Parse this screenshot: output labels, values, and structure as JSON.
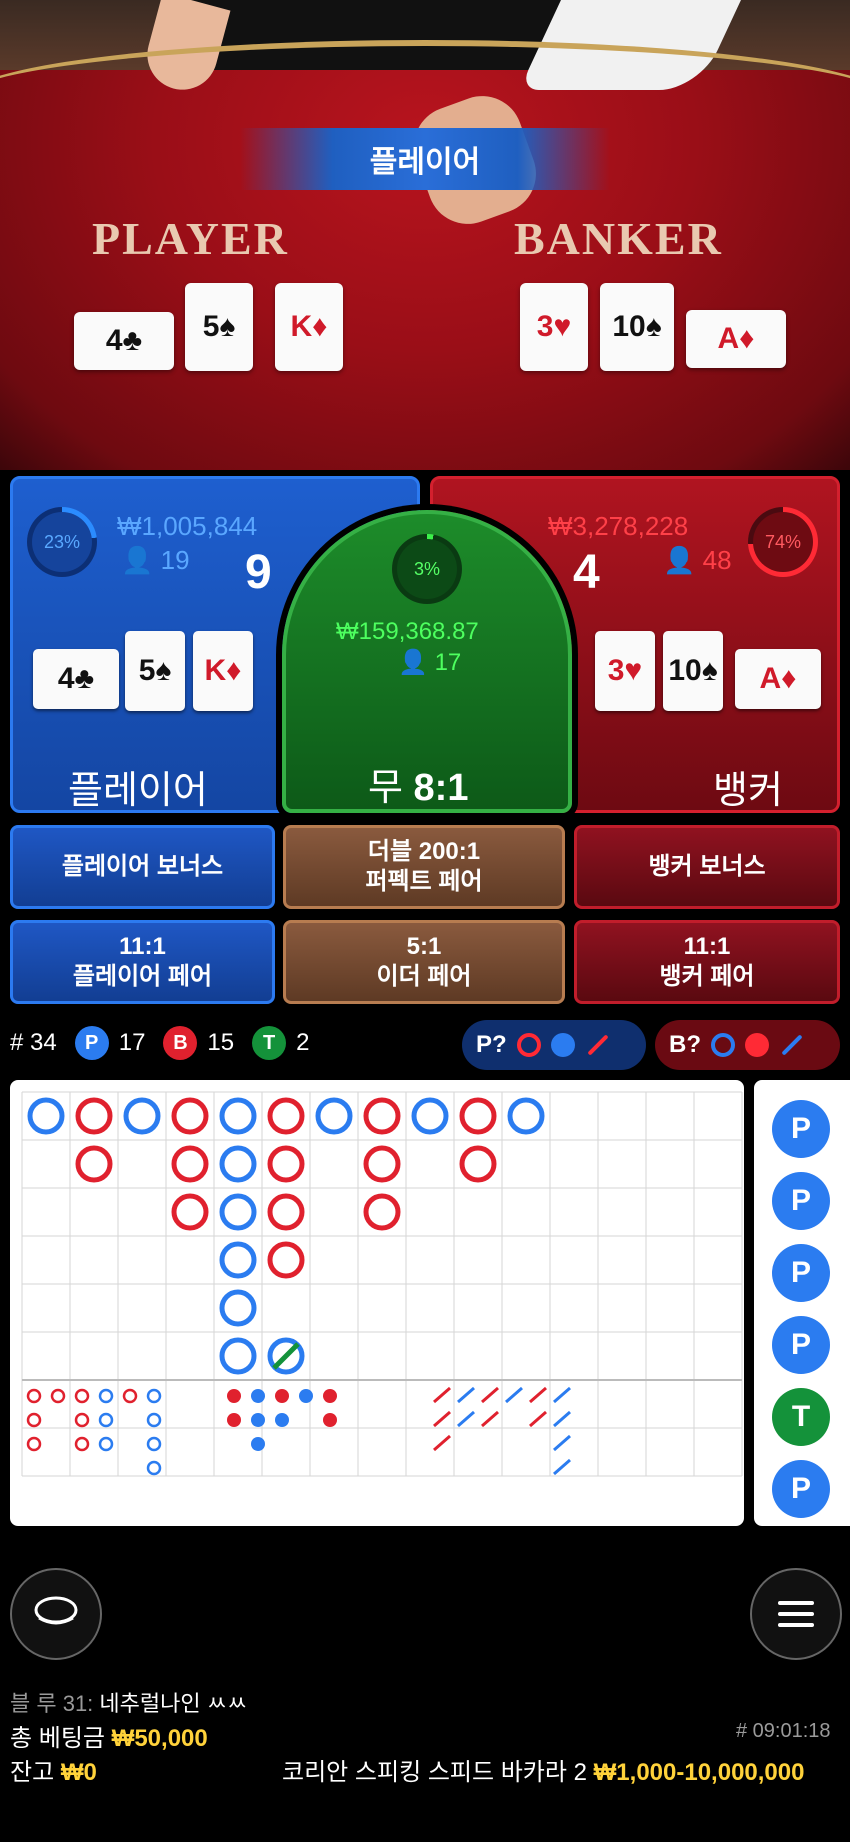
{
  "video": {
    "banner": "플레이어",
    "player_label": "PLAYER",
    "banker_label": "BANKER",
    "player_cards": [
      {
        "rank": "4",
        "suit": "♣",
        "color": "black"
      },
      {
        "rank": "5",
        "suit": "♠",
        "color": "black"
      },
      {
        "rank": "K",
        "suit": "♦",
        "color": "red"
      }
    ],
    "banker_cards": [
      {
        "rank": "3",
        "suit": "♥",
        "color": "red"
      },
      {
        "rank": "10",
        "suit": "♠",
        "color": "black"
      },
      {
        "rank": "A",
        "suit": "♦",
        "color": "red"
      }
    ]
  },
  "bets": {
    "player": {
      "percent": "23%",
      "percent_value": 0.23,
      "amount": "₩1,005,844",
      "bettors": "19",
      "score": "9",
      "label": "플레이어",
      "cards": [
        "4♣",
        "5♠",
        "K♦"
      ]
    },
    "tie": {
      "percent": "3%",
      "percent_value": 0.03,
      "amount": "₩159,368.87",
      "bettors": "17",
      "label": "무",
      "payout": "8:1"
    },
    "banker": {
      "percent": "74%",
      "percent_value": 0.74,
      "amount": "₩3,278,228",
      "bettors": "48",
      "score": "4",
      "label": "뱅커",
      "cards": [
        "3♥",
        "10♠",
        "A♦"
      ]
    }
  },
  "side_bets": {
    "player_bonus": "플레이어 보너스",
    "perfect_pair_odds": "더블 200:1",
    "perfect_pair": "퍼펙트 페어",
    "banker_bonus": "뱅커 보너스",
    "player_pair_odds": "11:1",
    "player_pair": "플레이어 페어",
    "either_pair_odds": "5:1",
    "either_pair": "이더 페어",
    "banker_pair_odds": "11:1",
    "banker_pair": "뱅커 페어"
  },
  "stats": {
    "rounds": "# 34",
    "p_letter": "P",
    "p_count": "17",
    "b_letter": "B",
    "b_count": "15",
    "t_letter": "T",
    "t_count": "2",
    "player_predict": "P?",
    "banker_predict": "B?"
  },
  "bead_road": [
    "P",
    "P",
    "P",
    "P",
    "T",
    "P"
  ],
  "colors": {
    "player": "#2b7cf0",
    "banker": "#e0212e",
    "tie": "#14923a",
    "gold": "#ffd23a"
  },
  "footer": {
    "chat_user": "블 루 31:",
    "chat_message": "네추럴나인 ㅆㅆ",
    "total_bet_label": "총 베팅금",
    "total_bet_value": "₩50,000",
    "balance_label": "잔고",
    "balance_value": "₩0",
    "game_id": "# 09:01:18",
    "table_name": "코리안 스피킹 스피드 바카라 2",
    "limits": "₩1,000-10,000,000"
  }
}
